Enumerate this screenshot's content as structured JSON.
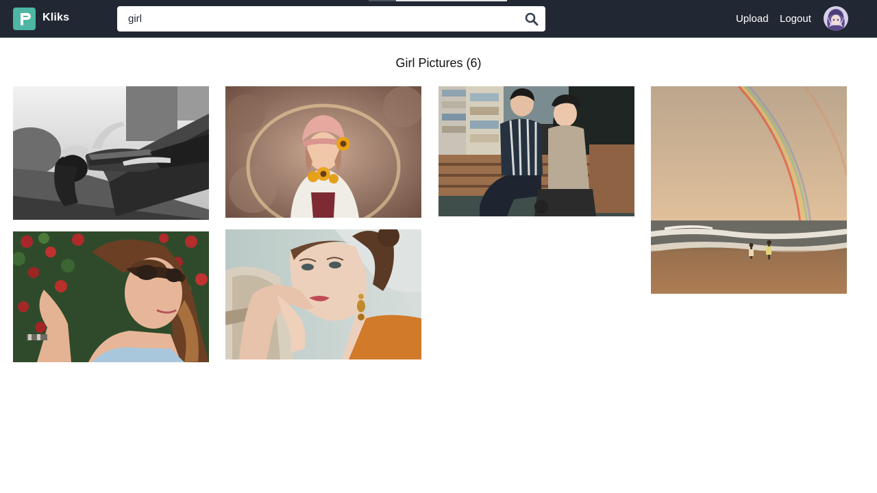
{
  "header": {
    "brand": "Kliks",
    "search": {
      "value": "girl",
      "placeholder": ""
    },
    "nav": {
      "upload": "Upload",
      "logout": "Logout"
    }
  },
  "colors": {
    "topbar": "#222833",
    "logo_bg": "#4db6a4",
    "search_icon": "#374151"
  },
  "icons": {
    "logo": "kliks-logo-icon",
    "search": "search-icon",
    "avatar": "user-avatar"
  },
  "gallery": {
    "title": "Girl Pictures (6)",
    "photos": [
      {
        "name": "photo-bw-woman-lying-on-bench"
      },
      {
        "name": "photo-girl-with-sunflowers"
      },
      {
        "name": "photo-couple-on-bench"
      },
      {
        "name": "photo-beach-rainbow"
      },
      {
        "name": "photo-woman-sunglasses-flowers"
      },
      {
        "name": "photo-woman-portrait-earring"
      }
    ]
  }
}
